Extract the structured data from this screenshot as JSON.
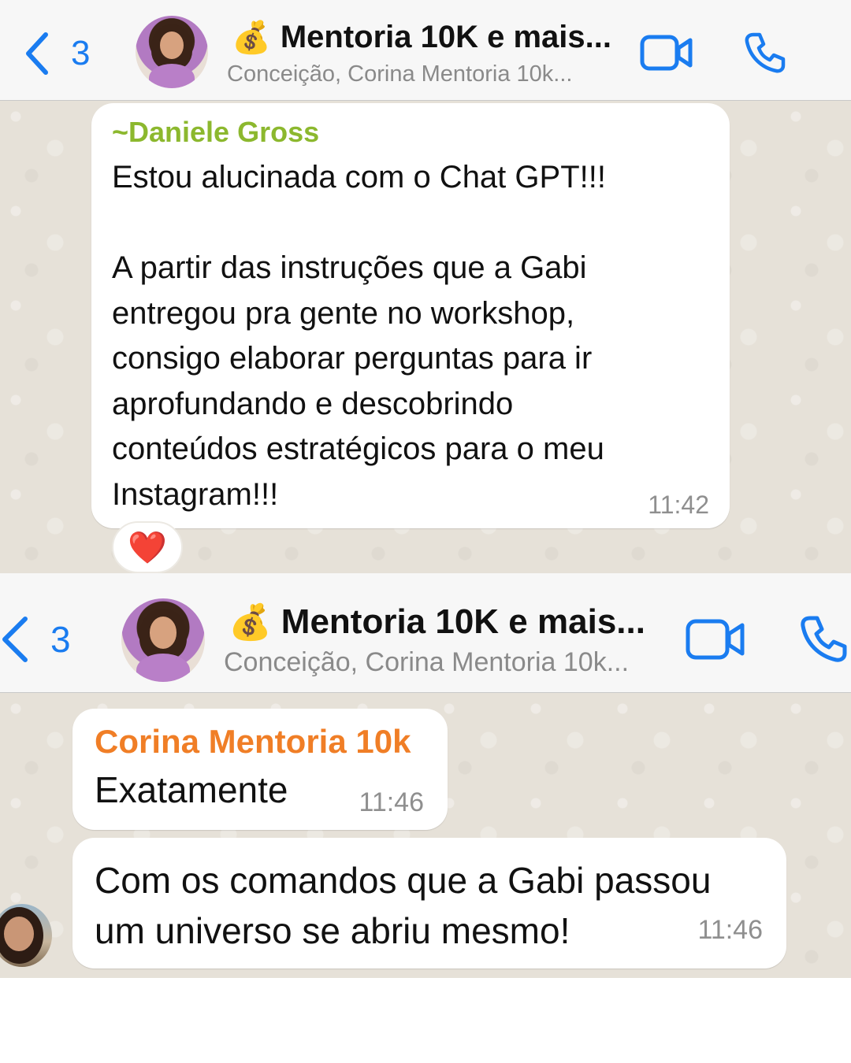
{
  "screens": [
    {
      "back_count": "3",
      "group_emoji": "💰",
      "group_title": "Mentoria 10K e mais...",
      "group_subtitle": "Conceição, Corina Mentoria 10k...",
      "messages": [
        {
          "sender": "~Daniele Gross",
          "sender_color": "#8cb82e",
          "lines": [
            "Estou alucinada com o Chat GPT!!!",
            "",
            "A partir das instruções que a Gabi",
            "entregou pra gente no workshop,",
            "consigo elaborar perguntas para ir",
            "aprofundando e descobrindo",
            "conteúdos estratégicos para o meu",
            "Instagram!!!"
          ],
          "time": "11:42",
          "reaction": "❤️"
        }
      ]
    },
    {
      "back_count": "3",
      "group_emoji": "💰",
      "group_title": "Mentoria 10K e mais...",
      "group_subtitle": "Conceição, Corina Mentoria 10k...",
      "messages": [
        {
          "sender": "Corina Mentoria 10k",
          "sender_color": "#f07e26",
          "text": "Exatamente",
          "time": "11:46"
        },
        {
          "lines": [
            "Com os comandos que a Gabi passou",
            "um universo se abriu mesmo!"
          ],
          "time": "11:46"
        }
      ]
    }
  ],
  "colors": {
    "ios_blue": "#1a7cf0",
    "header_bg": "#f7f7f7",
    "chat_bg": "#e6e1d8"
  },
  "icons": [
    "chevron-left-icon",
    "video-camera-icon",
    "phone-icon",
    "money-bag-icon",
    "heart-icon"
  ]
}
